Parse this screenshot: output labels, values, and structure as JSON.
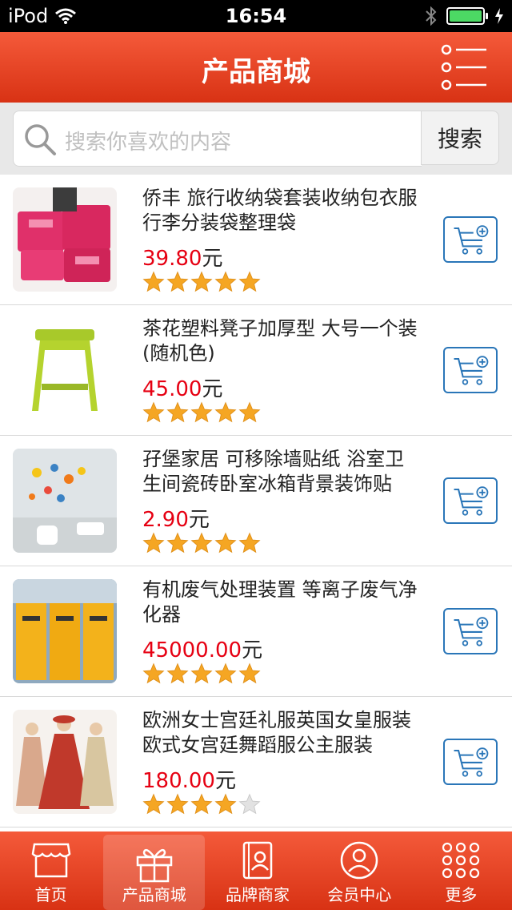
{
  "status": {
    "carrier": "iPod",
    "time": "16:54"
  },
  "header": {
    "title": "产品商城"
  },
  "search": {
    "placeholder": "搜索你喜欢的内容",
    "button_label": "搜索"
  },
  "products": [
    {
      "title": "侨丰 旅行收纳袋套装收纳包衣服行李分装袋整理袋",
      "price": "39.80",
      "unit": "元",
      "rating": 5
    },
    {
      "title": "茶花塑料凳子加厚型 大号一个装(随机色)",
      "price": "45.00",
      "unit": "元",
      "rating": 5
    },
    {
      "title": "孖堡家居 可移除墙贴纸 浴室卫生间瓷砖卧室冰箱背景装饰贴",
      "price": "2.90",
      "unit": "元",
      "rating": 5
    },
    {
      "title": "有机废气处理装置 等离子废气净化器",
      "price": "45000.00",
      "unit": "元",
      "rating": 5
    },
    {
      "title": "欧洲女士宫廷礼服英国女皇服装欧式女宫廷舞蹈服公主服装",
      "price": "180.00",
      "unit": "元",
      "rating": 4
    }
  ],
  "tabs": [
    {
      "label": "首页",
      "icon": "shop-icon"
    },
    {
      "label": "产品商城",
      "icon": "gift-icon"
    },
    {
      "label": "品牌商家",
      "icon": "brand-book-icon"
    },
    {
      "label": "会员中心",
      "icon": "user-icon"
    },
    {
      "label": "更多",
      "icon": "grid-dots-icon"
    }
  ],
  "colors": {
    "header": "#e4421f",
    "price": "#e60012",
    "star": "#f5a623",
    "cart": "#2a76b8"
  }
}
